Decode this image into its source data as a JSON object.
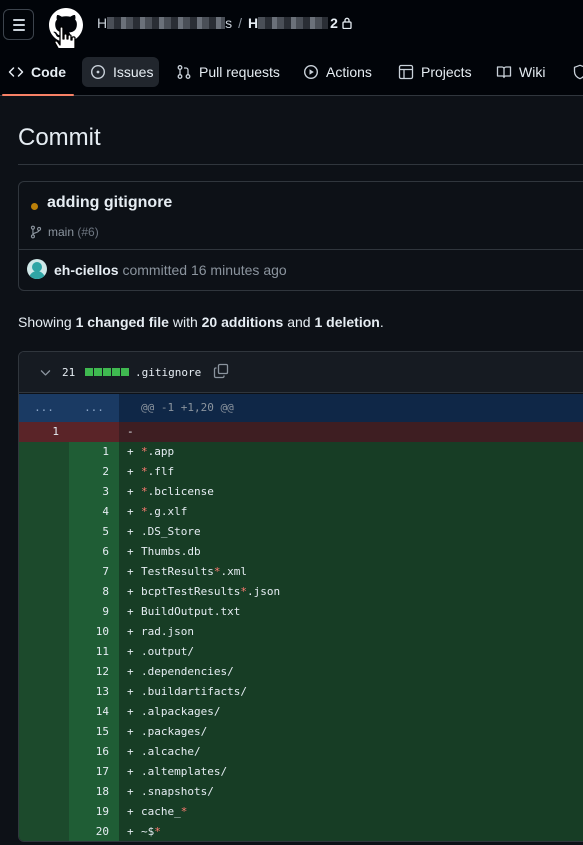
{
  "header": {
    "owner_prefix": "H",
    "owner_suffix": "s",
    "separator": "/",
    "repo_prefix": "H",
    "repo_suffix": "2"
  },
  "tabs": [
    {
      "label": "Code",
      "icon": "code-icon"
    },
    {
      "label": "Issues",
      "icon": "issue-opened-icon"
    },
    {
      "label": "Pull requests",
      "icon": "git-pull-request-icon"
    },
    {
      "label": "Actions",
      "icon": "play-icon"
    },
    {
      "label": "Projects",
      "icon": "table-icon"
    },
    {
      "label": "Wiki",
      "icon": "book-icon"
    }
  ],
  "page": {
    "title": "Commit"
  },
  "commit": {
    "message": "adding gitignore",
    "branch": "main",
    "pr_ref": "(#6)",
    "author": "eh-ciellos",
    "action": "committed",
    "time": "16 minutes ago",
    "status_color": "#bb8009"
  },
  "summary": {
    "showing": "Showing",
    "changed": "1 changed file",
    "with": "with",
    "additions": "20 additions",
    "and": "and",
    "deletions": "1 deletion",
    "end": "."
  },
  "file": {
    "change_count": "21",
    "name": ".gitignore",
    "hunk_left": "...",
    "hunk_right": "...",
    "hunk_header": "@@ -1 +1,20 @@"
  },
  "diff": [
    {
      "type": "del",
      "old": "1",
      "new": "",
      "mark": "-",
      "text": ""
    },
    {
      "type": "add",
      "old": "",
      "new": "1",
      "mark": "+",
      "text": "*.app"
    },
    {
      "type": "add",
      "old": "",
      "new": "2",
      "mark": "+",
      "text": "*.flf"
    },
    {
      "type": "add",
      "old": "",
      "new": "3",
      "mark": "+",
      "text": "*.bclicense"
    },
    {
      "type": "add",
      "old": "",
      "new": "4",
      "mark": "+",
      "text": "*.g.xlf"
    },
    {
      "type": "add",
      "old": "",
      "new": "5",
      "mark": "+",
      "text": ".DS_Store"
    },
    {
      "type": "add",
      "old": "",
      "new": "6",
      "mark": "+",
      "text": "Thumbs.db"
    },
    {
      "type": "add",
      "old": "",
      "new": "7",
      "mark": "+",
      "text": "TestResults*.xml"
    },
    {
      "type": "add",
      "old": "",
      "new": "8",
      "mark": "+",
      "text": "bcptTestResults*.json"
    },
    {
      "type": "add",
      "old": "",
      "new": "9",
      "mark": "+",
      "text": "BuildOutput.txt"
    },
    {
      "type": "add",
      "old": "",
      "new": "10",
      "mark": "+",
      "text": "rad.json"
    },
    {
      "type": "add",
      "old": "",
      "new": "11",
      "mark": "+",
      "text": ".output/"
    },
    {
      "type": "add",
      "old": "",
      "new": "12",
      "mark": "+",
      "text": ".dependencies/"
    },
    {
      "type": "add",
      "old": "",
      "new": "13",
      "mark": "+",
      "text": ".buildartifacts/"
    },
    {
      "type": "add",
      "old": "",
      "new": "14",
      "mark": "+",
      "text": ".alpackages/"
    },
    {
      "type": "add",
      "old": "",
      "new": "15",
      "mark": "+",
      "text": ".packages/"
    },
    {
      "type": "add",
      "old": "",
      "new": "16",
      "mark": "+",
      "text": ".alcache/"
    },
    {
      "type": "add",
      "old": "",
      "new": "17",
      "mark": "+",
      "text": ".altemplates/"
    },
    {
      "type": "add",
      "old": "",
      "new": "18",
      "mark": "+",
      "text": ".snapshots/"
    },
    {
      "type": "add",
      "old": "",
      "new": "19",
      "mark": "+",
      "text": "cache_*"
    },
    {
      "type": "add",
      "old": "",
      "new": "20",
      "mark": "+",
      "text": "~$*"
    }
  ]
}
